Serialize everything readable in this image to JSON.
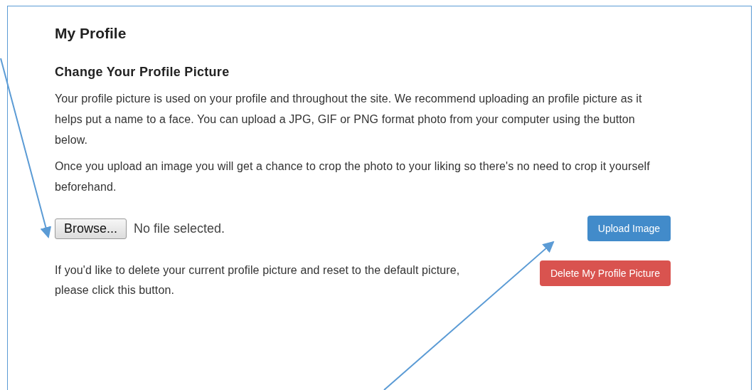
{
  "page": {
    "title": "My Profile"
  },
  "section": {
    "heading": "Change Your Profile Picture",
    "paragraphs": [
      "Your profile picture is used on your profile and throughout the site. We recommend uploading an profile picture as it helps put a name to a face. You can upload a JPG, GIF or PNG format photo from your computer using the button below.",
      "Once you upload an image you will get a chance to crop the photo to your liking so there's no need to crop it yourself beforehand."
    ]
  },
  "file_input": {
    "button": "Browse...",
    "status": "No file selected."
  },
  "upload_button": "Upload Image",
  "delete": {
    "text": "If you'd like to delete your current profile picture and reset to the default picture, please click this button.",
    "button": "Delete My Profile Picture"
  }
}
